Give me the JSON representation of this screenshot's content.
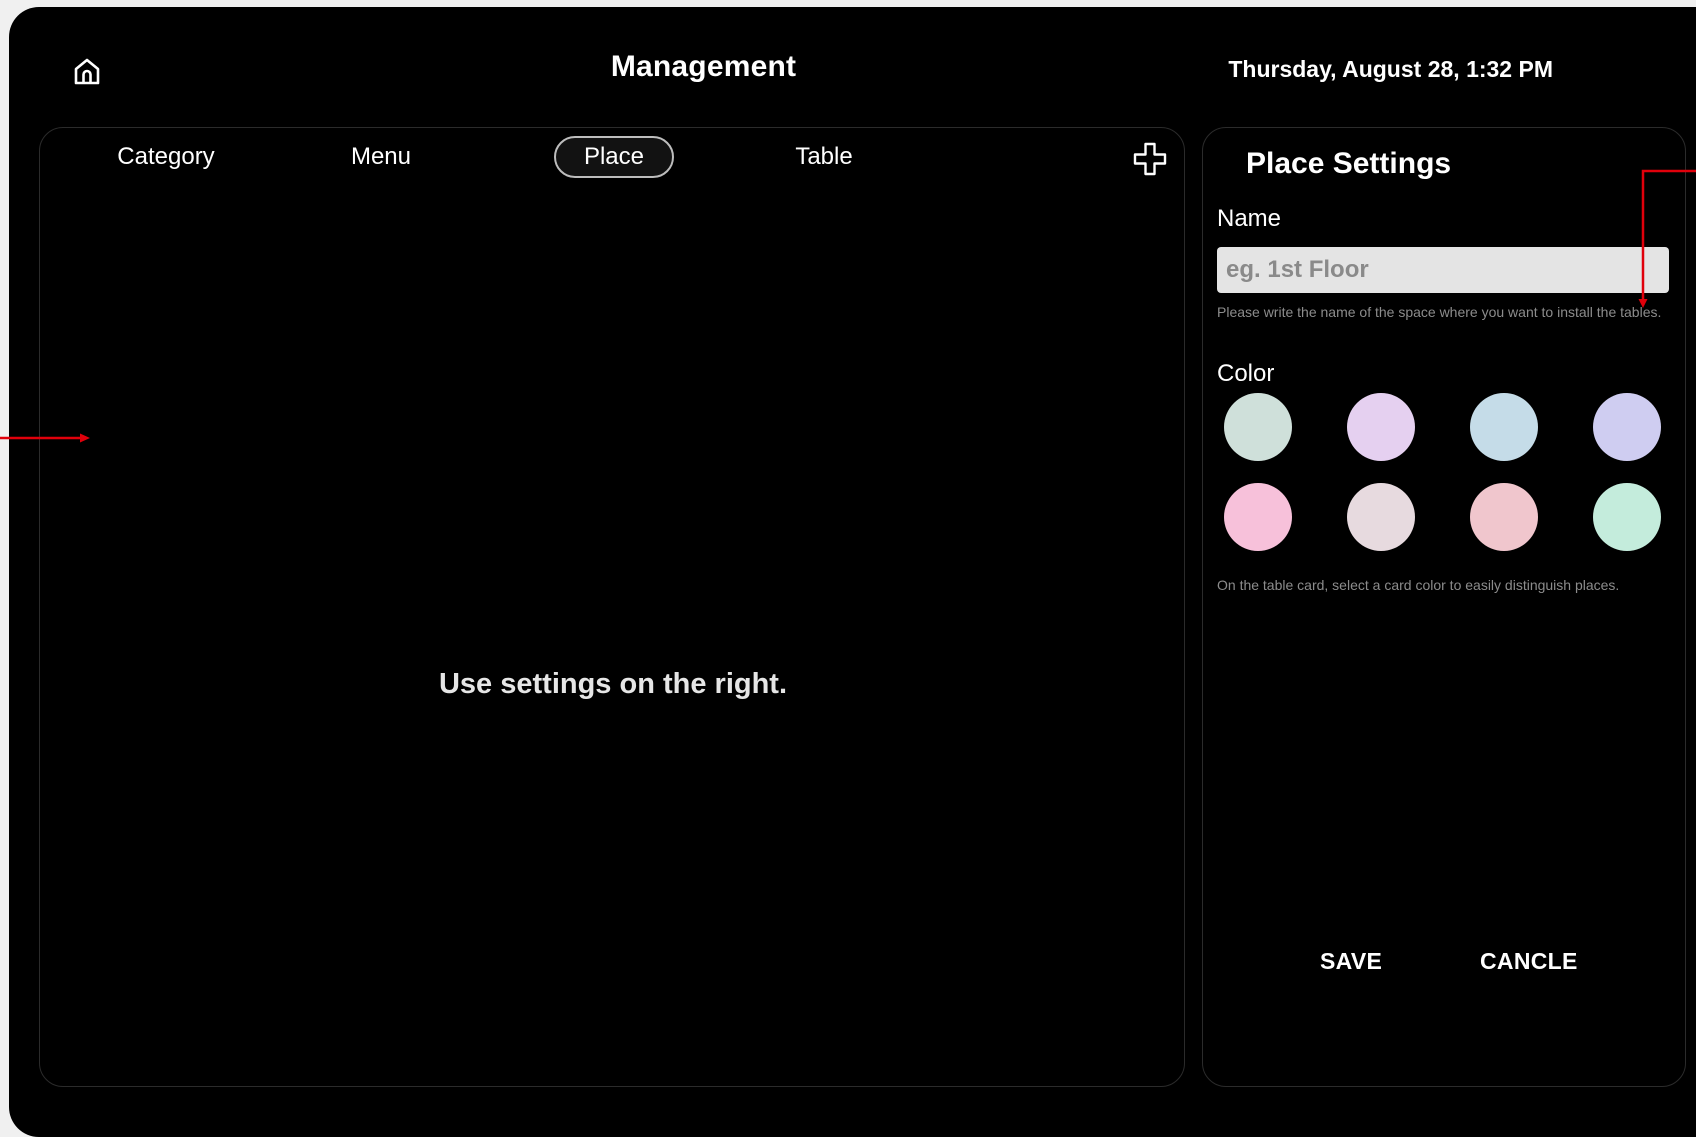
{
  "header": {
    "home_icon": "home-icon",
    "title": "Management",
    "datetime": "Thursday, August 28, 1:32 PM"
  },
  "tabs": [
    {
      "label": "Category",
      "active": false
    },
    {
      "label": "Menu",
      "active": false
    },
    {
      "label": "Place",
      "active": true
    },
    {
      "label": "Table",
      "active": false
    }
  ],
  "add_icon": "plus-icon",
  "main": {
    "empty_message": "Use settings on the right."
  },
  "settings": {
    "title": "Place Settings",
    "name_label": "Name",
    "name_placeholder": "eg. 1st Floor",
    "name_value": "",
    "name_hint": "Please write the name of the space where you want to install the tables.",
    "color_label": "Color",
    "colors": [
      "#cfe0da",
      "#e5d0f0",
      "#c5dce8",
      "#cfcdf1",
      "#f7c1da",
      "#e7dadf",
      "#f0c6cd",
      "#c4ecdc"
    ],
    "color_hint": "On the table card, select a card color to easily distinguish places.",
    "save_label": "SAVE",
    "cancel_label": "CANCLE"
  },
  "annotation_color": "#e0000b"
}
